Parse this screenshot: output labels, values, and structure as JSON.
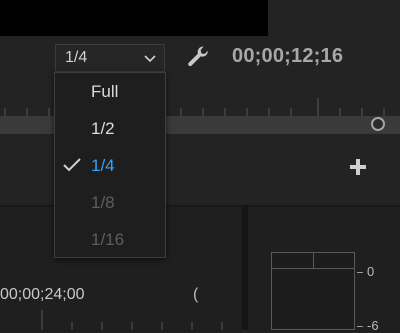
{
  "monitor": {
    "resolution_value": "1/4",
    "timecode": "00;00;12;16",
    "timeline_timecode": "00;00;24;00",
    "bracket_glyph": "("
  },
  "resolution_menu": {
    "items": [
      {
        "label": "Full",
        "selected": false,
        "enabled": true
      },
      {
        "label": "1/2",
        "selected": false,
        "enabled": true
      },
      {
        "label": "1/4",
        "selected": true,
        "enabled": true
      },
      {
        "label": "1/8",
        "selected": false,
        "enabled": false
      },
      {
        "label": "1/16",
        "selected": false,
        "enabled": false
      }
    ]
  },
  "meter": {
    "labels": [
      "0",
      "-6"
    ]
  },
  "icons": {
    "dropdown": "chevron-down-icon",
    "settings": "wrench-icon",
    "add": "plus-icon",
    "selected": "checkmark-icon"
  },
  "colors": {
    "selected_item": "#3aa0f5",
    "enabled_item": "#dcdcdc",
    "disabled_item": "#5e5e5e"
  }
}
